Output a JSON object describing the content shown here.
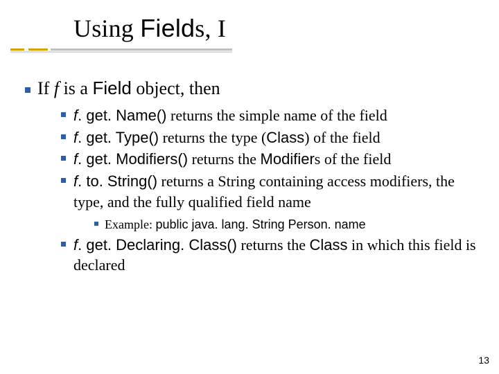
{
  "title": {
    "pre": "Using ",
    "code": "Field",
    "post": "s, I"
  },
  "intro": {
    "pre": "If ",
    "var": "f",
    "mid": " is a ",
    "code": "Field",
    "post": " object, then"
  },
  "items": [
    {
      "var": "f",
      "call": ". get. Name()",
      "text": " returns the simple name of the field"
    },
    {
      "var": "f",
      "call": ". get. Type()",
      "text_pre": " returns the type (",
      "code_in": "Class",
      "text_post": ") of the field"
    },
    {
      "var": "f",
      "call": ". get. Modifiers()",
      "text_pre": " returns the ",
      "code_in": "Modifier",
      "text_post": "s of the field"
    },
    {
      "var": "f",
      "call": ". to. String()",
      "text": " returns a String containing access modifiers, the type, and the fully qualified field name",
      "example": {
        "label": "Example: ",
        "code": "public java. lang. String Person. name"
      }
    },
    {
      "var": "f",
      "call": ". get. Declaring. Class()",
      "text_pre": " returns the ",
      "code_in": "Class",
      "text_post": " in which this field is declared"
    }
  ],
  "page_number": "13"
}
